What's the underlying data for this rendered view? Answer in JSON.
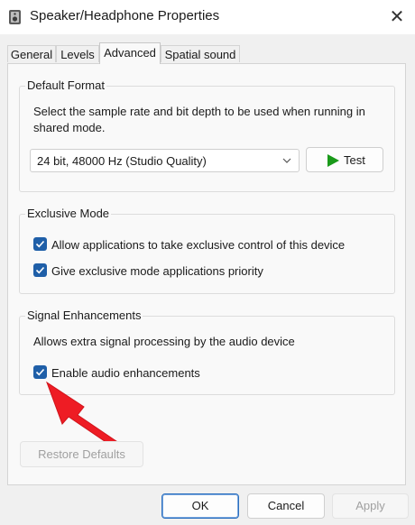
{
  "window": {
    "title": "Speaker/Headphone Properties"
  },
  "tabs": [
    {
      "label": "General"
    },
    {
      "label": "Levels"
    },
    {
      "label": "Advanced"
    },
    {
      "label": "Spatial sound"
    }
  ],
  "default_format": {
    "title": "Default Format",
    "description_line1": "Select the sample rate and bit depth to be used when running in",
    "description_line2": "shared mode.",
    "selected_format": "24 bit, 48000 Hz (Studio Quality)",
    "test_label": "Test"
  },
  "exclusive_mode": {
    "title": "Exclusive Mode",
    "option1": "Allow applications to take exclusive control of this device",
    "option2": "Give exclusive mode applications priority"
  },
  "signal": {
    "title": "Signal Enhancements",
    "description": "Allows extra signal processing by the audio device",
    "option": "Enable audio enhancements"
  },
  "restore_label": "Restore Defaults",
  "footer": {
    "ok": "OK",
    "cancel": "Cancel",
    "apply": "Apply"
  },
  "colors": {
    "accent": "#1f5fa8",
    "annotation_arrow": "#ee1c24",
    "test_triangle": "#1a9a1a"
  }
}
